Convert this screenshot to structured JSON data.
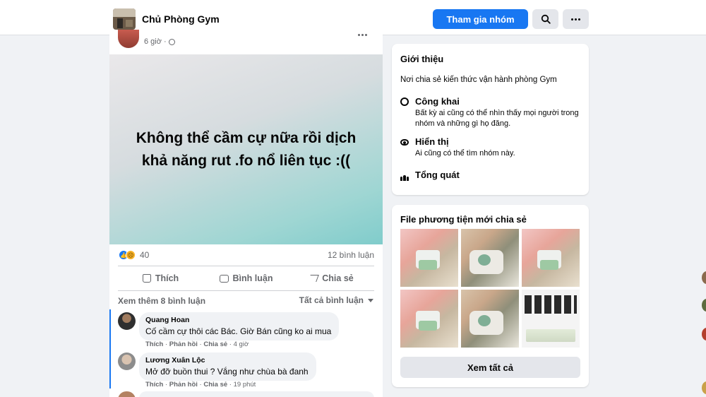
{
  "header": {
    "group_name": "Chủ Phòng Gym",
    "join_label": "Tham gia nhóm",
    "search_icon": "search-icon",
    "more_icon": "more-icon"
  },
  "post": {
    "time": "6 giờ ·",
    "text": "Không thể cầm cự nữa rồi dịch khả năng rut .fo nổ liên tục :((",
    "reaction_count": "40",
    "comment_count": "12 bình luận",
    "actions": {
      "like": "Thích",
      "comment": "Bình luận",
      "share": "Chia sẻ"
    },
    "more_comments": "Xem thêm 8 bình luận",
    "sort_label": "Tất cả bình luận",
    "comments": [
      {
        "author": "Quang Hoan",
        "text": "Cố cầm cự thôi các Bác. Giờ Bán cũng ko ai mua",
        "like": "Thích",
        "reply": "Phản hồi",
        "share": "Chia sẻ",
        "time": "4 giờ"
      },
      {
        "author": "Lương Xuân Lộc",
        "text": "Mở đỡ buồn thui ? Vắng như chùa bà đanh",
        "like": "Thích",
        "reply": "Phản hồi",
        "share": "Chia sẻ",
        "time": "19 phút"
      }
    ]
  },
  "intro": {
    "title": "Giới thiệu",
    "description": "Nơi chia sẻ kiến thức vận hành phòng Gym",
    "public_title": "Công khai",
    "public_desc": "Bất kỳ ai cũng có thể nhìn thấy mọi người trong nhóm và những gì họ đăng.",
    "visible_title": "Hiển thị",
    "visible_desc": "Ai cũng có thể tìm nhóm này.",
    "general_title": "Tổng quát"
  },
  "media": {
    "title": "File phương tiện mới chia sẻ",
    "see_all": "Xem tất cả"
  },
  "colors": {
    "accent": "#1877f2",
    "page_bg": "#f0f2f5"
  }
}
